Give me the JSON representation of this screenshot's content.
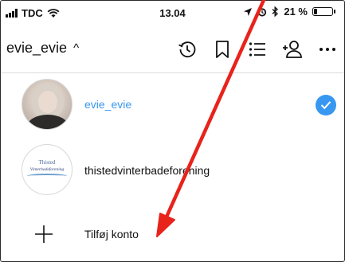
{
  "status_bar": {
    "carrier": "TDC",
    "time": "13.04",
    "battery_text": "21 %",
    "battery_level": 0.21
  },
  "header": {
    "username": "evie_evie",
    "chevron": "^",
    "icons": [
      "history-icon",
      "bookmark-icon",
      "list-icon",
      "add-person-icon",
      "more-icon"
    ]
  },
  "accounts": [
    {
      "username": "evie_evie",
      "active": true
    },
    {
      "username": "thistedvinterbadeforening",
      "active": false,
      "logo_text_top": "Thisted",
      "logo_text_main": "Vinterbadeforening"
    }
  ],
  "add_account": {
    "label": "Tilføj konto"
  },
  "colors": {
    "accent": "#3897f0",
    "annotation_arrow": "#e8231b",
    "divider": "#dbdbdb"
  }
}
